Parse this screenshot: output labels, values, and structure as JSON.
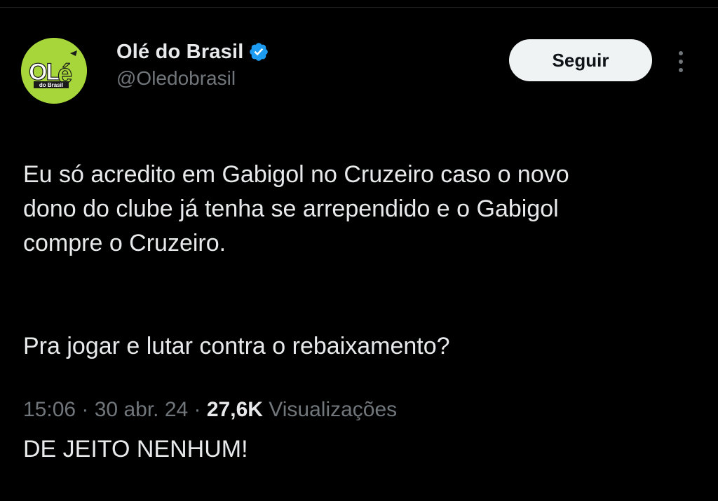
{
  "author": {
    "display_name": "Olé do Brasil",
    "handle": "@Oledobrasil",
    "verified": true,
    "avatar_logo_text": "OLÉ",
    "avatar_logo_subtext": "do Brasil"
  },
  "actions": {
    "follow_label": "Seguir",
    "more_icon": "more-vertical-icon"
  },
  "tweet": {
    "paragraphs": [
      "Eu só acredito em Gabigol no Cruzeiro caso o novo\ndono do clube já tenha se arrependido e o Gabigol\ncompre o Cruzeiro.",
      "Pra jogar e lutar contra o rebaixamento?",
      "DE JEITO NENHUM!"
    ]
  },
  "meta": {
    "time": "15:06",
    "separator": " · ",
    "date": "30 abr. 24",
    "views_count": "27,6K",
    "views_label": " Visualizações"
  },
  "colors": {
    "background": "#000000",
    "text_primary": "#e7e9ea",
    "text_secondary": "#71767b",
    "follow_bg": "#eff3f4",
    "verified_blue": "#1d9bf0",
    "avatar_green": "#a6d63a"
  }
}
